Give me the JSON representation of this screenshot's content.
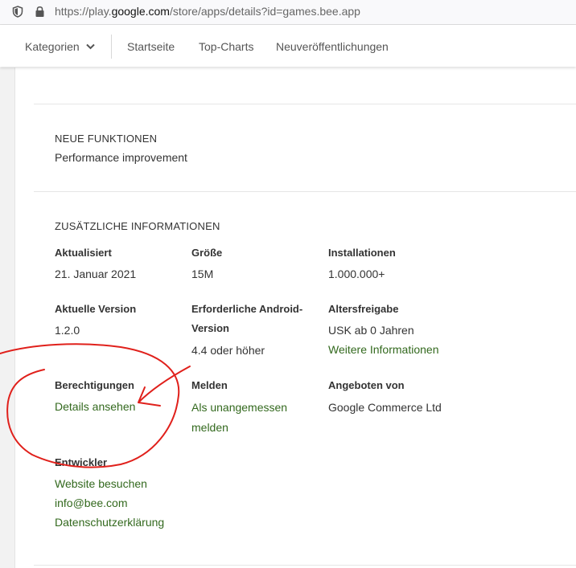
{
  "browser": {
    "url_prefix": "https://play.",
    "url_domain": "google.com",
    "url_suffix": "/store/apps/details?id=games.bee.app",
    "icons": [
      "shield-icon",
      "lock-icon"
    ]
  },
  "nav": {
    "categories": "Kategorien",
    "home": "Startseite",
    "charts": "Top-Charts",
    "new": "Neuveröffentlichungen"
  },
  "whats_new": {
    "title": "NEUE FUNKTIONEN",
    "body": "Performance improvement"
  },
  "info": {
    "title": "ZUSÄTZLICHE INFORMATIONEN",
    "updated_label": "Aktualisiert",
    "updated_value": "21. Januar 2021",
    "size_label": "Größe",
    "size_value": "15M",
    "installs_label": "Installationen",
    "installs_value": "1.000.000+",
    "version_label": "Aktuelle Version",
    "version_value": "1.2.0",
    "android_label_1": "Erforderliche Android-",
    "android_label_2": "Version",
    "android_value": "4.4 oder höher",
    "rating_label": "Altersfreigabe",
    "rating_value": "USK ab 0 Jahren",
    "rating_link": "Weitere Informationen",
    "permissions_label": "Berechtigungen",
    "permissions_link": "Details ansehen",
    "report_label": "Melden",
    "report_link_1": "Als unangemessen",
    "report_link_2": "melden",
    "offered_label": "Angeboten von",
    "offered_value": "Google Commerce Ltd",
    "developer_label": "Entwickler",
    "developer_website": "Website besuchen",
    "developer_email": "info@bee.com",
    "developer_privacy": "Datenschutzerklärung"
  },
  "annotation": {
    "color": "#e0201b"
  }
}
